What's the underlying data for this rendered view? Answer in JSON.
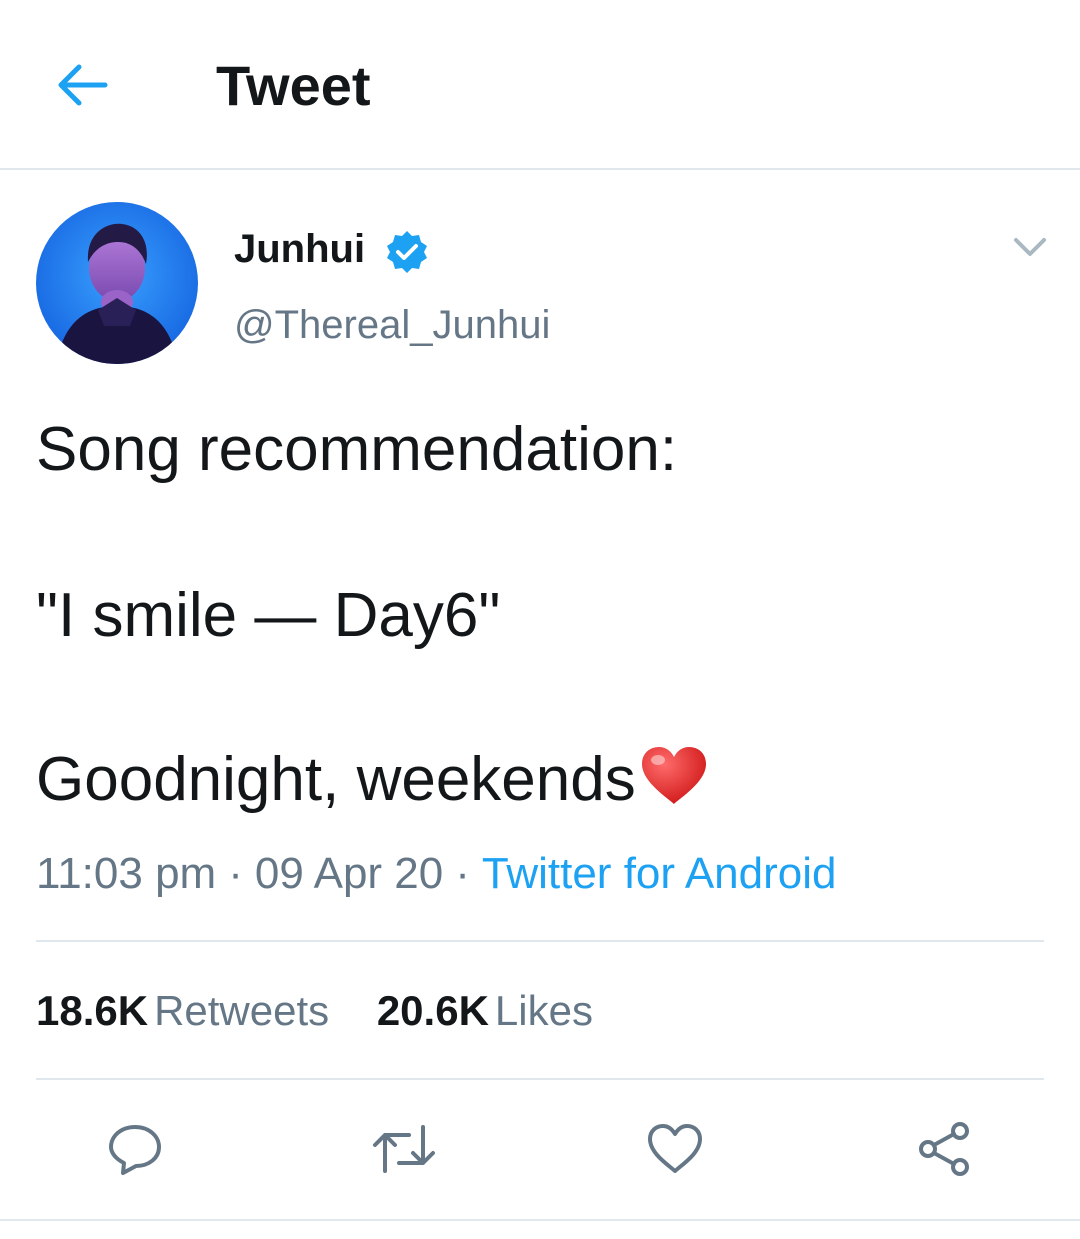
{
  "header": {
    "title": "Tweet",
    "back_icon": "arrow-left-icon"
  },
  "tweet": {
    "author": {
      "name": "Junhui",
      "handle": "@Thereal_Junhui",
      "verified": true
    },
    "text_lines": [
      "Song recommendation:",
      "\"I smile — Day6\"",
      "Goodnight, weekends"
    ],
    "emoji": "red-heart-icon",
    "time": "11:03 pm",
    "separator": "·",
    "date": "09 Apr 20",
    "source": "Twitter for Android",
    "stats": {
      "retweets_count": "18.6K",
      "retweets_label": "Retweets",
      "likes_count": "20.6K",
      "likes_label": "Likes"
    }
  },
  "actions": [
    "reply-icon",
    "retweet-icon",
    "like-icon",
    "share-icon"
  ],
  "colors": {
    "accent": "#1da1f2",
    "text_primary": "#14171a",
    "text_secondary": "#657786",
    "divider": "#e1e8ed",
    "heart": "#e0245e"
  }
}
